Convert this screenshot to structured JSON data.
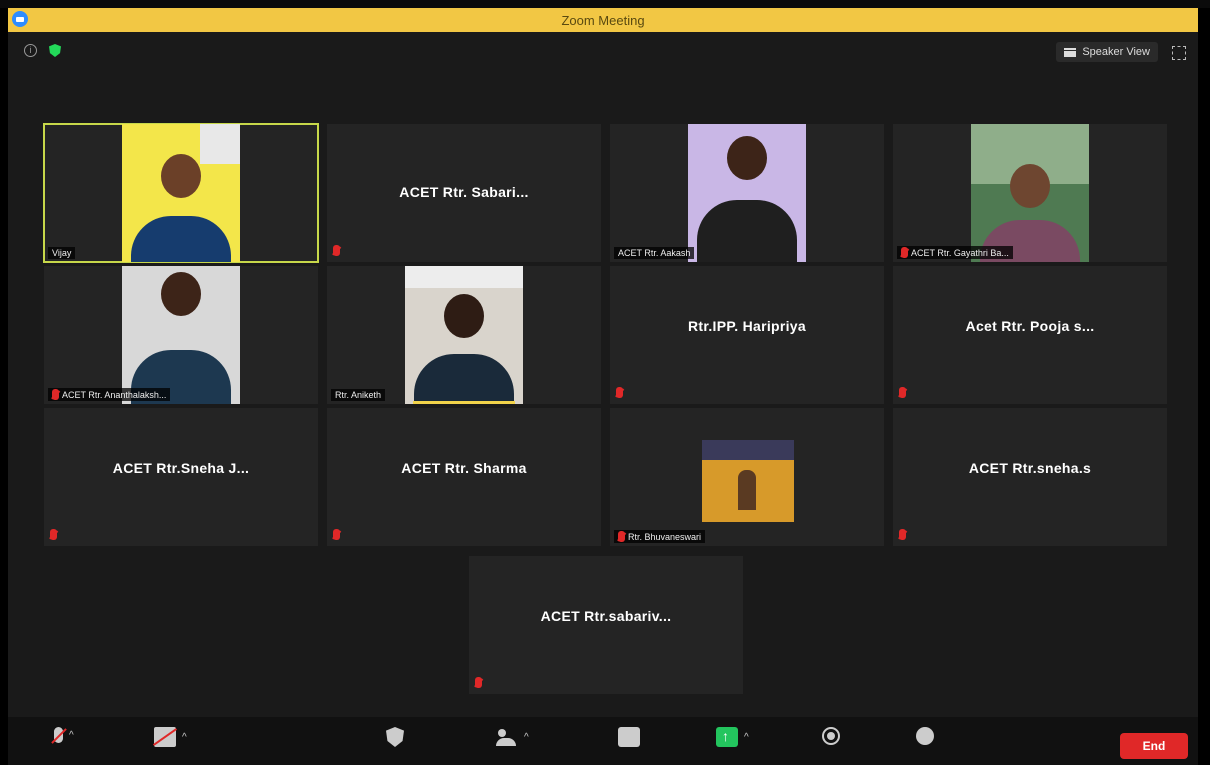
{
  "window": {
    "title": "Zoom Meeting"
  },
  "header": {
    "view_label": "Speaker View"
  },
  "tiles": [
    {
      "name": "Vijay",
      "label": "Vijay",
      "has_video": true,
      "active": true
    },
    {
      "name": "ACET Rtr. Sabari...",
      "has_video": false
    },
    {
      "name": "ACET Rtr. Aakash",
      "label": "ACET Rtr. Aakash",
      "has_video": true
    },
    {
      "name": "ACET Rtr. Gayathri",
      "label": "ACET Rtr. Gayathri Ba...",
      "has_video": true
    },
    {
      "name": "ACET Rtr. Ananthalakshmi",
      "label": "ACET Rtr. Ananthalaksh...",
      "has_video": true
    },
    {
      "name": "Rtr. Aniketh",
      "label": "Rtr. Aniketh",
      "has_video": true,
      "speaking": true
    },
    {
      "name": "Rtr.IPP. Haripriya",
      "has_video": false
    },
    {
      "name": "Acet Rtr. Pooja s...",
      "has_video": false
    },
    {
      "name": "ACET Rtr.Sneha J...",
      "has_video": false
    },
    {
      "name": "ACET Rtr. Sharma",
      "has_video": false
    },
    {
      "name": "Rtr. Bhuvaneswari",
      "label": "Rtr. Bhuvaneswari",
      "has_video": true
    },
    {
      "name": "ACET Rtr.sneha.s",
      "has_video": false
    },
    {
      "name": "ACET Rtr.sabariv...",
      "has_video": false
    }
  ],
  "toolbar": {
    "end_label": "End"
  },
  "colors": {
    "title_bar": "#f2c744",
    "active_border": "#c7d84a",
    "end": "#e02828",
    "share": "#23c55e"
  }
}
